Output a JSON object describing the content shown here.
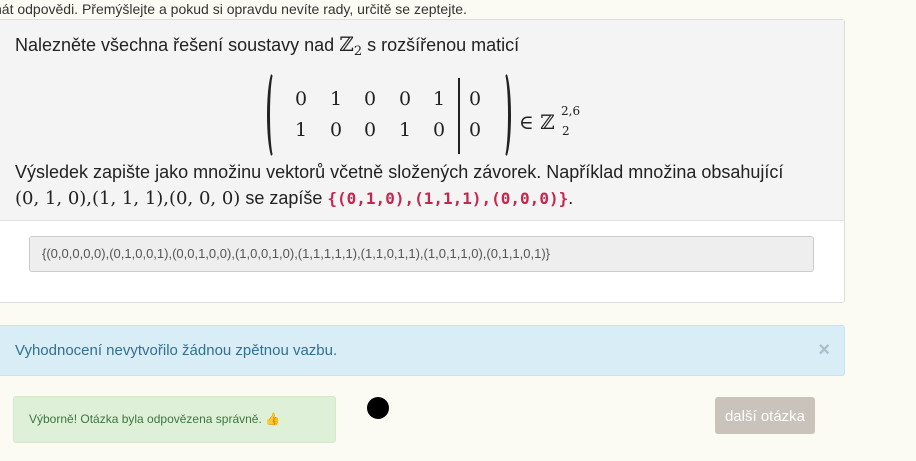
{
  "top_note": "nát odpovědi. Přemýšlejte a pokud si opravdu nevíte rady, určitě se zeptejte.",
  "question": {
    "prefix": "Nalezněte všechna řešení soustavy nad",
    "set_symbol": "ℤ",
    "set_sub": "2",
    "suffix": "s rozšířenou maticí",
    "matrix": [
      [
        "0",
        "1",
        "0",
        "0",
        "1"
      ],
      [
        "1",
        "0",
        "0",
        "1",
        "0"
      ]
    ],
    "rhs": [
      "0",
      "0"
    ],
    "in_symbol": "∈ ℤ",
    "in_sup": "2,6",
    "in_sub": "2",
    "instruction_line1": "Výsledek zapište jako množinu vektorů včetně složených závorek. Například množina obsahující",
    "example_vectors": "(0, 1, 0),(1, 1, 1),(0, 0, 0)",
    "writes_as": "se zapíše",
    "example_code": "{(0,1,0),(1,1,1),(0,0,0)}",
    "period": "."
  },
  "answer_value": "{(0,0,0,0,0),(0,1,0,0,1),(0,0,1,0,0),(1,0,0,1,0),(1,1,1,1,1),(1,1,0,1,1),(1,0,1,1,0),(0,1,1,0,1)}",
  "feedback_info": "Vyhodnocení nevytvořilo žádnou zpětnou vazbu.",
  "close_label": "×",
  "success_text": "Výborně! Otázka byla odpovězena správně. 👍",
  "next_button": "další otázka"
}
